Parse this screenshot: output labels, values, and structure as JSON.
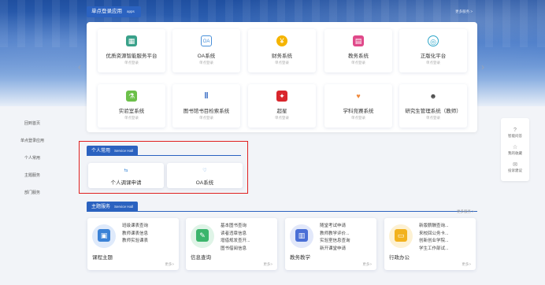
{
  "sso": {
    "title": "单点登录应用",
    "title_en": "apps",
    "more": "更多服务 >",
    "prev_icon": "‹",
    "next_icon": "›",
    "tiles": [
      {
        "name": "优质资源智能服务平台",
        "sub": "单点登录",
        "icon": "▦",
        "color": "#3aa18a"
      },
      {
        "name": "OA系统",
        "sub": "单点登录",
        "icon": "OA",
        "color": "#4a90d9"
      },
      {
        "name": "财务系统",
        "sub": "单点登录",
        "icon": "¥",
        "color": "#f5b400"
      },
      {
        "name": "教务系统",
        "sub": "单点登录",
        "icon": "▤",
        "color": "#e04a8a"
      },
      {
        "name": "正版化平台",
        "sub": "单点登录",
        "icon": "◎",
        "color": "#2ea6c8"
      },
      {
        "name": "实验室系统",
        "sub": "单点登录",
        "icon": "⚗",
        "color": "#6cc04a"
      },
      {
        "name": "图书馆书目检索系统",
        "sub": "单点登录",
        "icon": "‖",
        "color": "#2b62c0"
      },
      {
        "name": "超星",
        "sub": "单点登录",
        "icon": "✦",
        "color": "#d9262c"
      },
      {
        "name": "学科竞赛系统",
        "sub": "单点登录",
        "icon": "♥",
        "color": "#f08a3c"
      },
      {
        "name": "研究生管理系统（教师）",
        "sub": "单点登录",
        "icon": "☻",
        "color": "#444"
      }
    ]
  },
  "left_nav": [
    "回到首页",
    "单点登录应用",
    "个人常用",
    "主题服务",
    "部门服务"
  ],
  "right_float": [
    {
      "icon": "?",
      "label": "智能问答"
    },
    {
      "icon": "☆",
      "label": "我的收藏"
    },
    {
      "icon": "✉",
      "label": "投诉建议"
    }
  ],
  "hall": {
    "title": "个人常用",
    "title_en": "Service Hall",
    "cards": [
      {
        "icon": "⇆",
        "label": "个人调课申请"
      },
      {
        "icon": "♡",
        "label": "OA系统"
      }
    ]
  },
  "theme": {
    "title": "主题服务",
    "title_en": "Service Hall",
    "more": "更多服务 >",
    "cards": [
      {
        "category": "课程主题",
        "icon": "▣",
        "color": "#3b82d6",
        "bg": "#dfeafb",
        "links": [
          "班级课表查询",
          "教师课表信息",
          "教师实验课表"
        ],
        "more": "更多>"
      },
      {
        "category": "信息查询",
        "icon": "✎",
        "color": "#3bb56c",
        "bg": "#dff4e7",
        "links": [
          "基本图书查询",
          "读者违章信息",
          "增借规发查开...",
          "图书借阅信息"
        ],
        "more": "更多>"
      },
      {
        "category": "教务教学",
        "icon": "▥",
        "color": "#4a6fd6",
        "bg": "#e2e8fa",
        "links": [
          "随堂考试申请",
          "教师教学评价...",
          "实验室信息查询",
          "新开课堂申请"
        ],
        "more": "更多>"
      },
      {
        "category": "行政办公",
        "icon": "▭",
        "color": "#f2b21e",
        "bg": "#fdf1d3",
        "links": [
          "新版薪酬查询...",
          "来校回公务卡...",
          "创新创业学院...",
          "学生工作部试..."
        ],
        "more": "更多>"
      }
    ]
  }
}
